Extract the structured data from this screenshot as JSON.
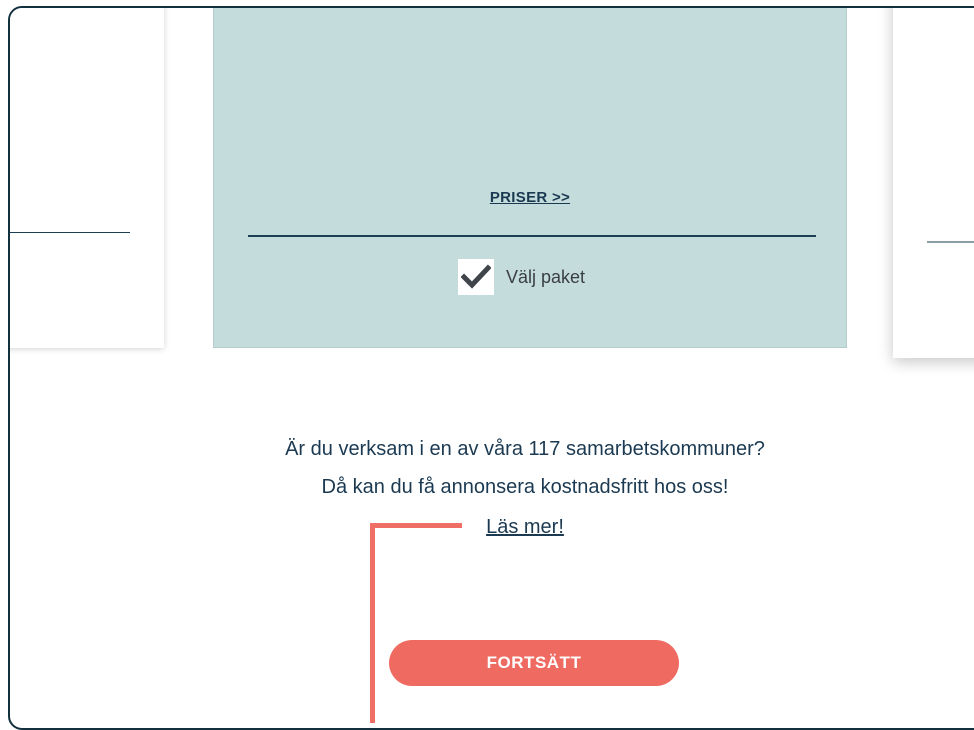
{
  "package_card": {
    "prices_link": "PRISER >>",
    "select_label": "Välj paket",
    "selected": true
  },
  "promo": {
    "line1": "Är du verksam i en av våra 117 samarbetskommuner?",
    "line2": "Då kan du få annonsera kostnadsfritt hos oss!",
    "read_more": "Läs mer!"
  },
  "actions": {
    "continue_label": "FORTSÄTT"
  },
  "colors": {
    "frame_border": "#12303e",
    "card_bg": "#c5dcdd",
    "text_primary": "#1b3a52",
    "accent": "#ef6b62",
    "annotation": "#ef6f66"
  }
}
